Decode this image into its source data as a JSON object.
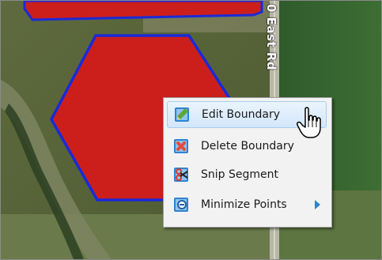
{
  "map": {
    "road_label": "0 East Rd"
  },
  "context_menu": {
    "items": [
      {
        "label": "Edit Boundary",
        "icon": "edit-boundary-icon",
        "active": true
      },
      {
        "label": "Delete Boundary",
        "icon": "delete-boundary-icon"
      },
      {
        "label": "Snip Segment",
        "icon": "snip-segment-icon"
      },
      {
        "label": "Minimize Points",
        "icon": "minimize-points-icon",
        "has_submenu": true
      }
    ]
  },
  "colors": {
    "boundary_fill": "#cc1f1c",
    "boundary_stroke": "#1a2ad8",
    "menu_highlight": "#d3e7fb",
    "submenu_arrow": "#2f7fd6"
  },
  "cursor": "hand-pointer-icon"
}
